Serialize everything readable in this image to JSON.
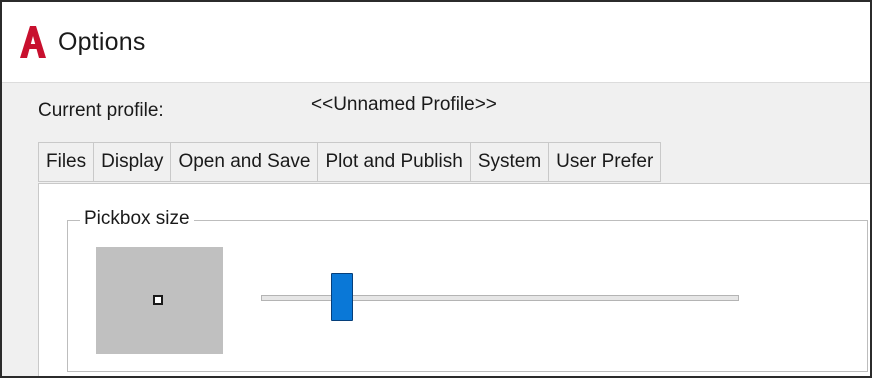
{
  "window": {
    "title": "Options",
    "icon": "autocad-a-icon",
    "accent_color": "#c8102e"
  },
  "profile": {
    "label": "Current profile:",
    "value": "<<Unnamed Profile>>"
  },
  "tabs": [
    {
      "label": "Files"
    },
    {
      "label": "Display"
    },
    {
      "label": "Open and Save"
    },
    {
      "label": "Plot and Publish"
    },
    {
      "label": "System"
    },
    {
      "label": "User Prefer"
    }
  ],
  "pickbox": {
    "group_label": "Pickbox size",
    "slider_color": "#0a78d7",
    "slider_fraction": 0.17
  }
}
